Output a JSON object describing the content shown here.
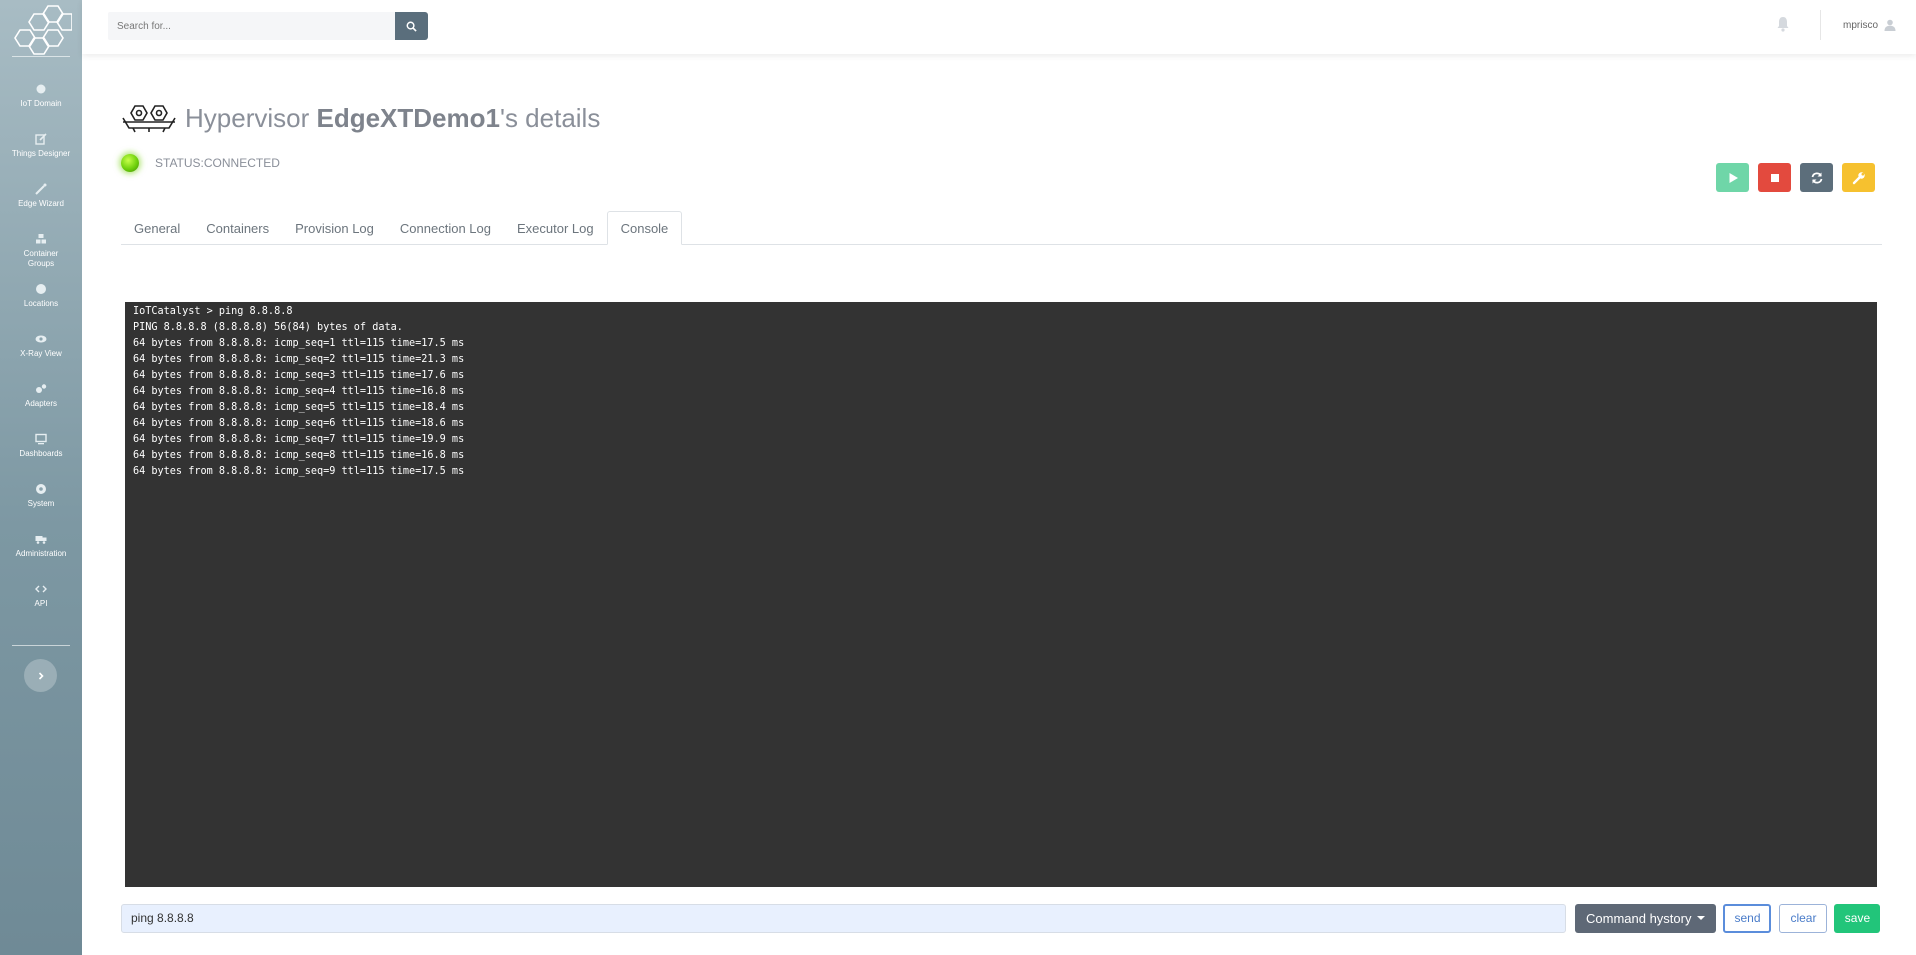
{
  "sidebar": {
    "items": [
      {
        "label": "IoT Domain",
        "icon": "domain-icon"
      },
      {
        "label": "Things Designer",
        "icon": "edit-icon"
      },
      {
        "label": "Edge Wizard",
        "icon": "magic-wand-icon"
      },
      {
        "label": "Container Groups",
        "icon": "cubes-icon"
      },
      {
        "label": "Locations",
        "icon": "globe-icon"
      },
      {
        "label": "X-Ray View",
        "icon": "eye-icon"
      },
      {
        "label": "Adapters",
        "icon": "cogs-icon"
      },
      {
        "label": "Dashboards",
        "icon": "monitor-icon"
      },
      {
        "label": "System",
        "icon": "gear-icon"
      },
      {
        "label": "Administration",
        "icon": "truck-icon"
      },
      {
        "label": "API",
        "icon": "code-icon"
      }
    ]
  },
  "topbar": {
    "search_placeholder": "Search for...",
    "username": "mprisco"
  },
  "page": {
    "title_prefix": "Hypervisor ",
    "title_name": "EdgeXTDemo1",
    "title_suffix": "'s details",
    "status": "STATUS:CONNECTED"
  },
  "tabs": [
    "General",
    "Containers",
    "Provision Log",
    "Connection Log",
    "Executor Log",
    "Console"
  ],
  "active_tab": "Console",
  "console": {
    "lines": [
      "IoTCatalyst > ping 8.8.8.8",
      "PING 8.8.8.8 (8.8.8.8) 56(84) bytes of data.",
      "64 bytes from 8.8.8.8: icmp_seq=1 ttl=115 time=17.5 ms",
      "64 bytes from 8.8.8.8: icmp_seq=2 ttl=115 time=21.3 ms",
      "64 bytes from 8.8.8.8: icmp_seq=3 ttl=115 time=17.6 ms",
      "64 bytes from 8.8.8.8: icmp_seq=4 ttl=115 time=16.8 ms",
      "64 bytes from 8.8.8.8: icmp_seq=5 ttl=115 time=18.4 ms",
      "64 bytes from 8.8.8.8: icmp_seq=6 ttl=115 time=18.6 ms",
      "64 bytes from 8.8.8.8: icmp_seq=7 ttl=115 time=19.9 ms",
      "64 bytes from 8.8.8.8: icmp_seq=8 ttl=115 time=16.8 ms",
      "64 bytes from 8.8.8.8: icmp_seq=9 ttl=115 time=17.5 ms"
    ]
  },
  "command": {
    "value": "ping 8.8.8.8",
    "history_label": "Command hystory",
    "send_label": "send",
    "clear_label": "clear",
    "save_label": "save"
  }
}
